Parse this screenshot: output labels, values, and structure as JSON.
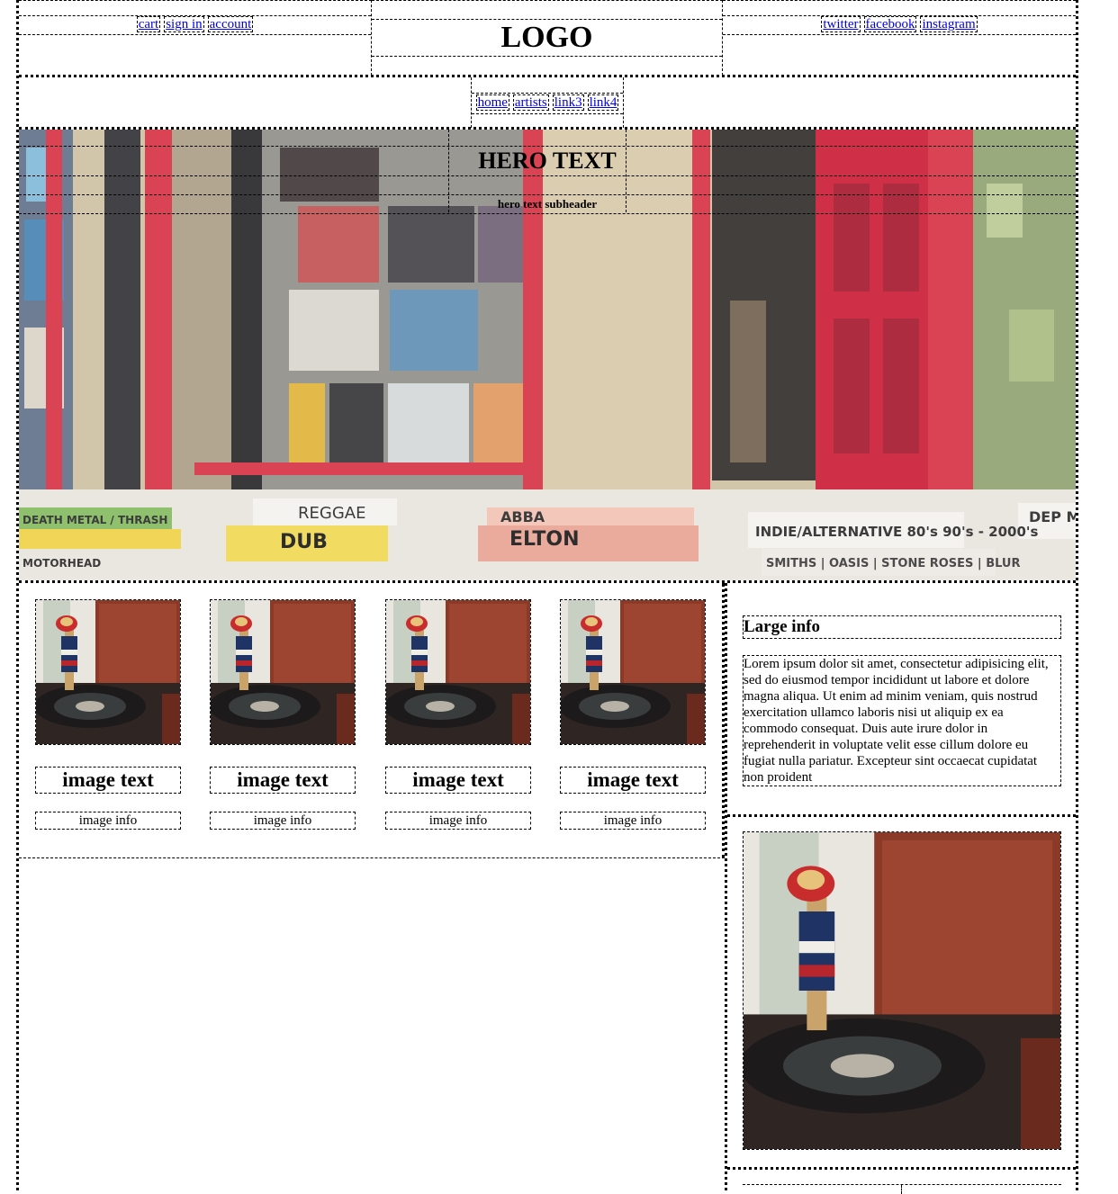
{
  "header": {
    "left_links": [
      "cart",
      "sign in",
      "account"
    ],
    "logo": "LOGO",
    "right_links": [
      "twitter",
      "facebook",
      "instagram"
    ]
  },
  "nav": {
    "links": [
      "home",
      "artists",
      "link3",
      "link4"
    ]
  },
  "hero": {
    "title": "HERO TEXT",
    "subtitle": "hero text subheader",
    "signs": [
      "REGGAE",
      "DUB",
      "ABBA",
      "ELTON",
      "INDIE/ALTERNATIVE 80's 90's - 2000's",
      "SMITHS | OASIS | STONE ROSES | BLUR",
      "DEATH METAL / THRASH",
      "MOTORHEAD",
      "DEP M"
    ]
  },
  "cards": [
    {
      "text": "image text",
      "info": "image info"
    },
    {
      "text": "image text",
      "info": "image info"
    },
    {
      "text": "image text",
      "info": "image info"
    },
    {
      "text": "image text",
      "info": "image info"
    }
  ],
  "sidebar": {
    "large_info": "Large info",
    "lorem": "Lorem ipsum dolor sit amet, consectetur adipisicing elit, sed do eiusmod tempor incididunt ut labore et dolore magna aliqua. Ut enim ad minim veniam, quis nostrud exercitation ullamco laboris nisi ut aliquip ex ea commodo consequat. Duis aute irure dolor in reprehenderit in voluptate velit esse cillum dolore eu fugiat nulla pariatur. Excepteur sint occaecat cupidatat non proident"
  },
  "colors": {
    "link": "#0000ee",
    "red_frame": "#d42a3c",
    "brick": "#c9b58f"
  }
}
